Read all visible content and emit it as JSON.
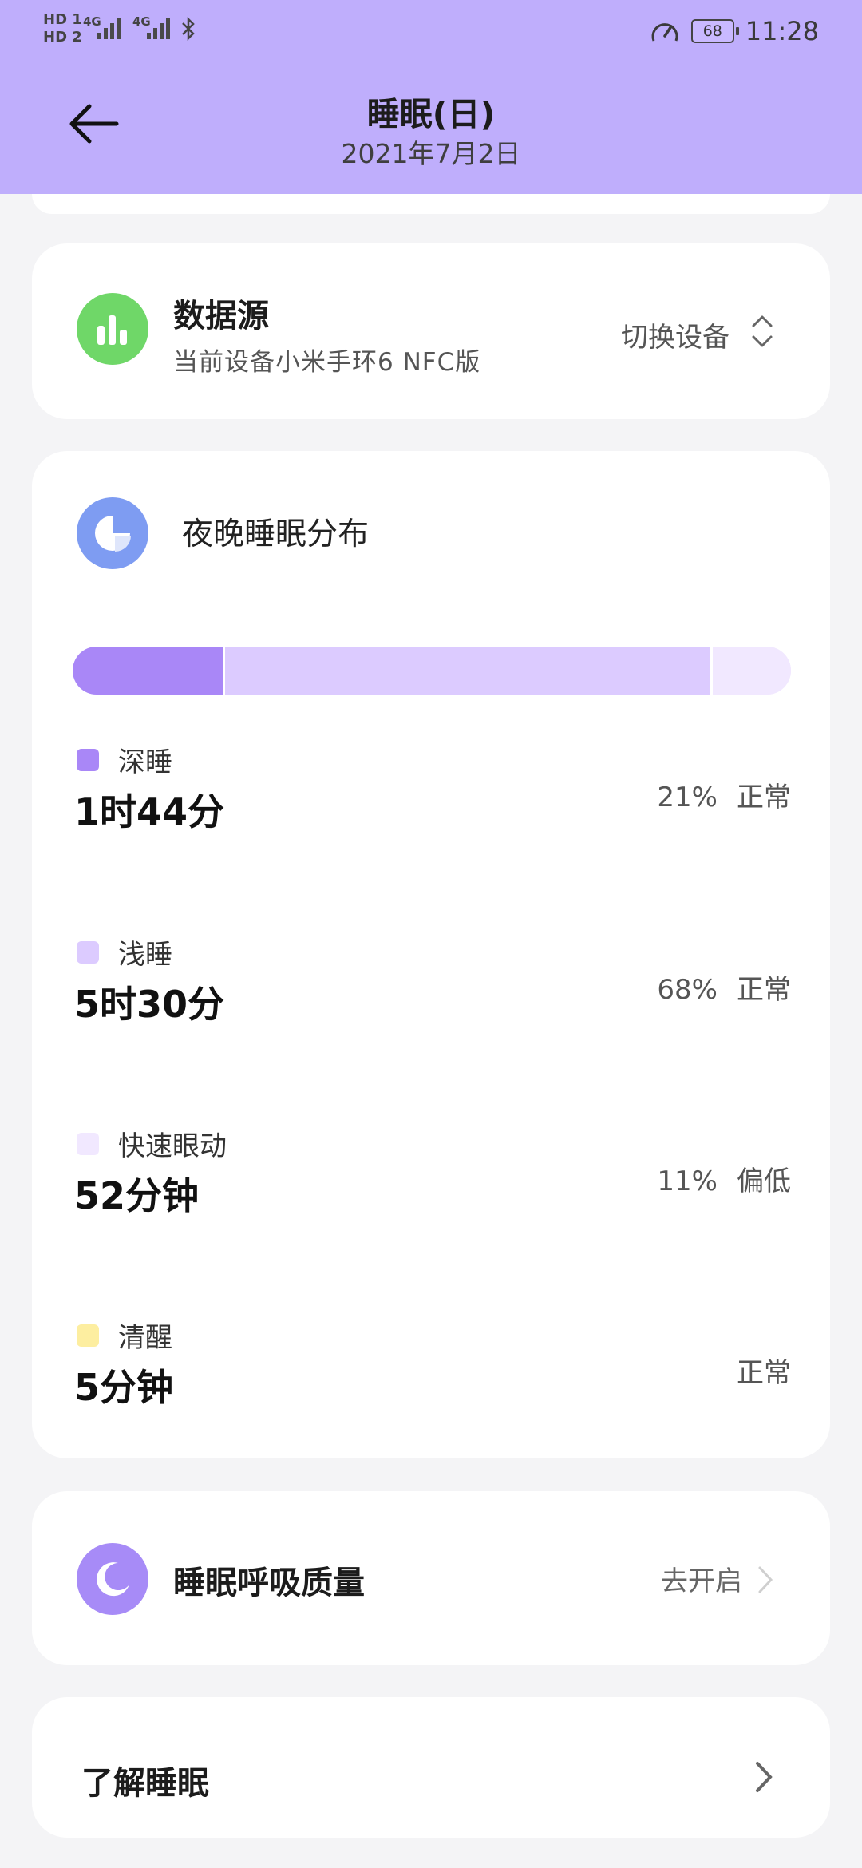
{
  "status_bar": {
    "hd1": "HD 1",
    "hd2": "HD 2",
    "net1": "4G",
    "net2": "4G",
    "battery": "68",
    "time": "11:28"
  },
  "header": {
    "title": "睡眠(日)",
    "date": "2021年7月2日"
  },
  "data_source": {
    "title": "数据源",
    "subtitle": "当前设备小米手环6 NFC版",
    "switch_label": "切换设备"
  },
  "sleep_distribution": {
    "title": "夜晚睡眠分布",
    "stages": [
      {
        "name": "深睡",
        "duration": "1时44分",
        "percent": "21%",
        "status": "正常",
        "color": "#a987f7",
        "share": 0.21
      },
      {
        "name": "浅睡",
        "duration": "5时30分",
        "percent": "68%",
        "status": "正常",
        "color": "#dccbff",
        "share": 0.68
      },
      {
        "name": "快速眼动",
        "duration": "52分钟",
        "percent": "11%",
        "status": "偏低",
        "color": "#f1e8ff",
        "share": 0.11
      },
      {
        "name": "清醒",
        "duration": "5分钟",
        "percent": "",
        "status": "正常",
        "color": "#fdeea0",
        "share": 0
      }
    ]
  },
  "breathing": {
    "title": "睡眠呼吸质量",
    "action": "去开启"
  },
  "learn": {
    "title": "了解睡眠"
  }
}
